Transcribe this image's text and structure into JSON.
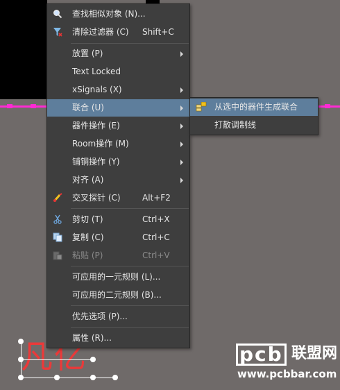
{
  "canvas": {
    "background": "#6f6a69",
    "component_text": "凡亿",
    "component_color": "#ea3a3a"
  },
  "watermark": {
    "brand": "pcb",
    "cn": "联盟网",
    "url": "www.pcbbar.com"
  },
  "menu": {
    "items": [
      {
        "label": "查找相似对象 (N)...",
        "icon": "search-icon"
      },
      {
        "label": "清除过滤器 (C)",
        "shortcut": "Shift+C",
        "icon": "clear-filter-icon"
      },
      {
        "label": "放置 (P)"
      },
      {
        "label": "Text Locked"
      },
      {
        "label": "xSignals (X)"
      },
      {
        "label": "联合 (U)"
      },
      {
        "label": "器件操作 (E)"
      },
      {
        "label": "Room操作 (M)"
      },
      {
        "label": "铺铜操作 (Y)"
      },
      {
        "label": "对齐 (A)"
      },
      {
        "label": "交叉探针 (C)",
        "shortcut": "Alt+F2",
        "icon": "cross-probe-icon"
      },
      {
        "label": "剪切 (T)",
        "shortcut": "Ctrl+X",
        "icon": "scissors-icon"
      },
      {
        "label": "复制 (C)",
        "shortcut": "Ctrl+C",
        "icon": "copy-icon"
      },
      {
        "label": "粘贴 (P)",
        "shortcut": "Ctrl+V",
        "icon": "paste-icon"
      },
      {
        "label": "可应用的一元规则 (L)..."
      },
      {
        "label": "可应用的二元规则 (B)..."
      },
      {
        "label": "优先选项 (P)..."
      },
      {
        "label": "属性 (R)..."
      }
    ],
    "active_color": "#5e7e9c"
  },
  "submenu": {
    "items": [
      {
        "label": "从选中的器件生成联合",
        "icon": "union-icon"
      },
      {
        "label": "打散调制线"
      }
    ]
  }
}
